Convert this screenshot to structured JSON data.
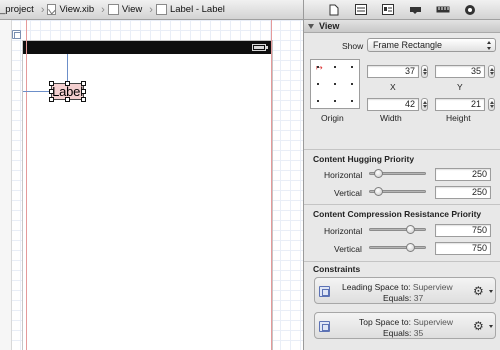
{
  "jump_bar": {
    "crumbs": [
      "_project",
      "View.xib",
      "View",
      "Label - Label"
    ]
  },
  "inspector_tabs": [
    "file-icon",
    "quick-help-icon",
    "identity-icon",
    "attributes-icon",
    "size-icon",
    "connections-icon"
  ],
  "canvas": {
    "label_text": "Label"
  },
  "view_section": {
    "title": "View",
    "show_label": "Show",
    "show_value": "Frame Rectangle",
    "origin_label": "Origin",
    "x": {
      "value": "37",
      "label": "X"
    },
    "y": {
      "value": "35",
      "label": "Y"
    },
    "width": {
      "value": "42",
      "label": "Width"
    },
    "height": {
      "value": "21",
      "label": "Height"
    }
  },
  "hugging": {
    "title": "Content Hugging Priority",
    "horizontal_label": "Horizontal",
    "horizontal_value": "250",
    "vertical_label": "Vertical",
    "vertical_value": "250"
  },
  "compression": {
    "title": "Content Compression Resistance Priority",
    "horizontal_label": "Horizontal",
    "horizontal_value": "750",
    "vertical_label": "Vertical",
    "vertical_value": "750"
  },
  "constraints": {
    "title": "Constraints",
    "items": [
      {
        "key": "Leading Space to:",
        "target": "Superview",
        "equals_label": "Equals:",
        "equals_value": "37"
      },
      {
        "key": "Top Space to:",
        "target": "Superview",
        "equals_label": "Equals:",
        "equals_value": "35"
      }
    ]
  },
  "colors": {
    "selection_fill": "#ebaaaa",
    "guide_blue": "#6c8fc9",
    "statusbar": "#0e0e0e"
  }
}
